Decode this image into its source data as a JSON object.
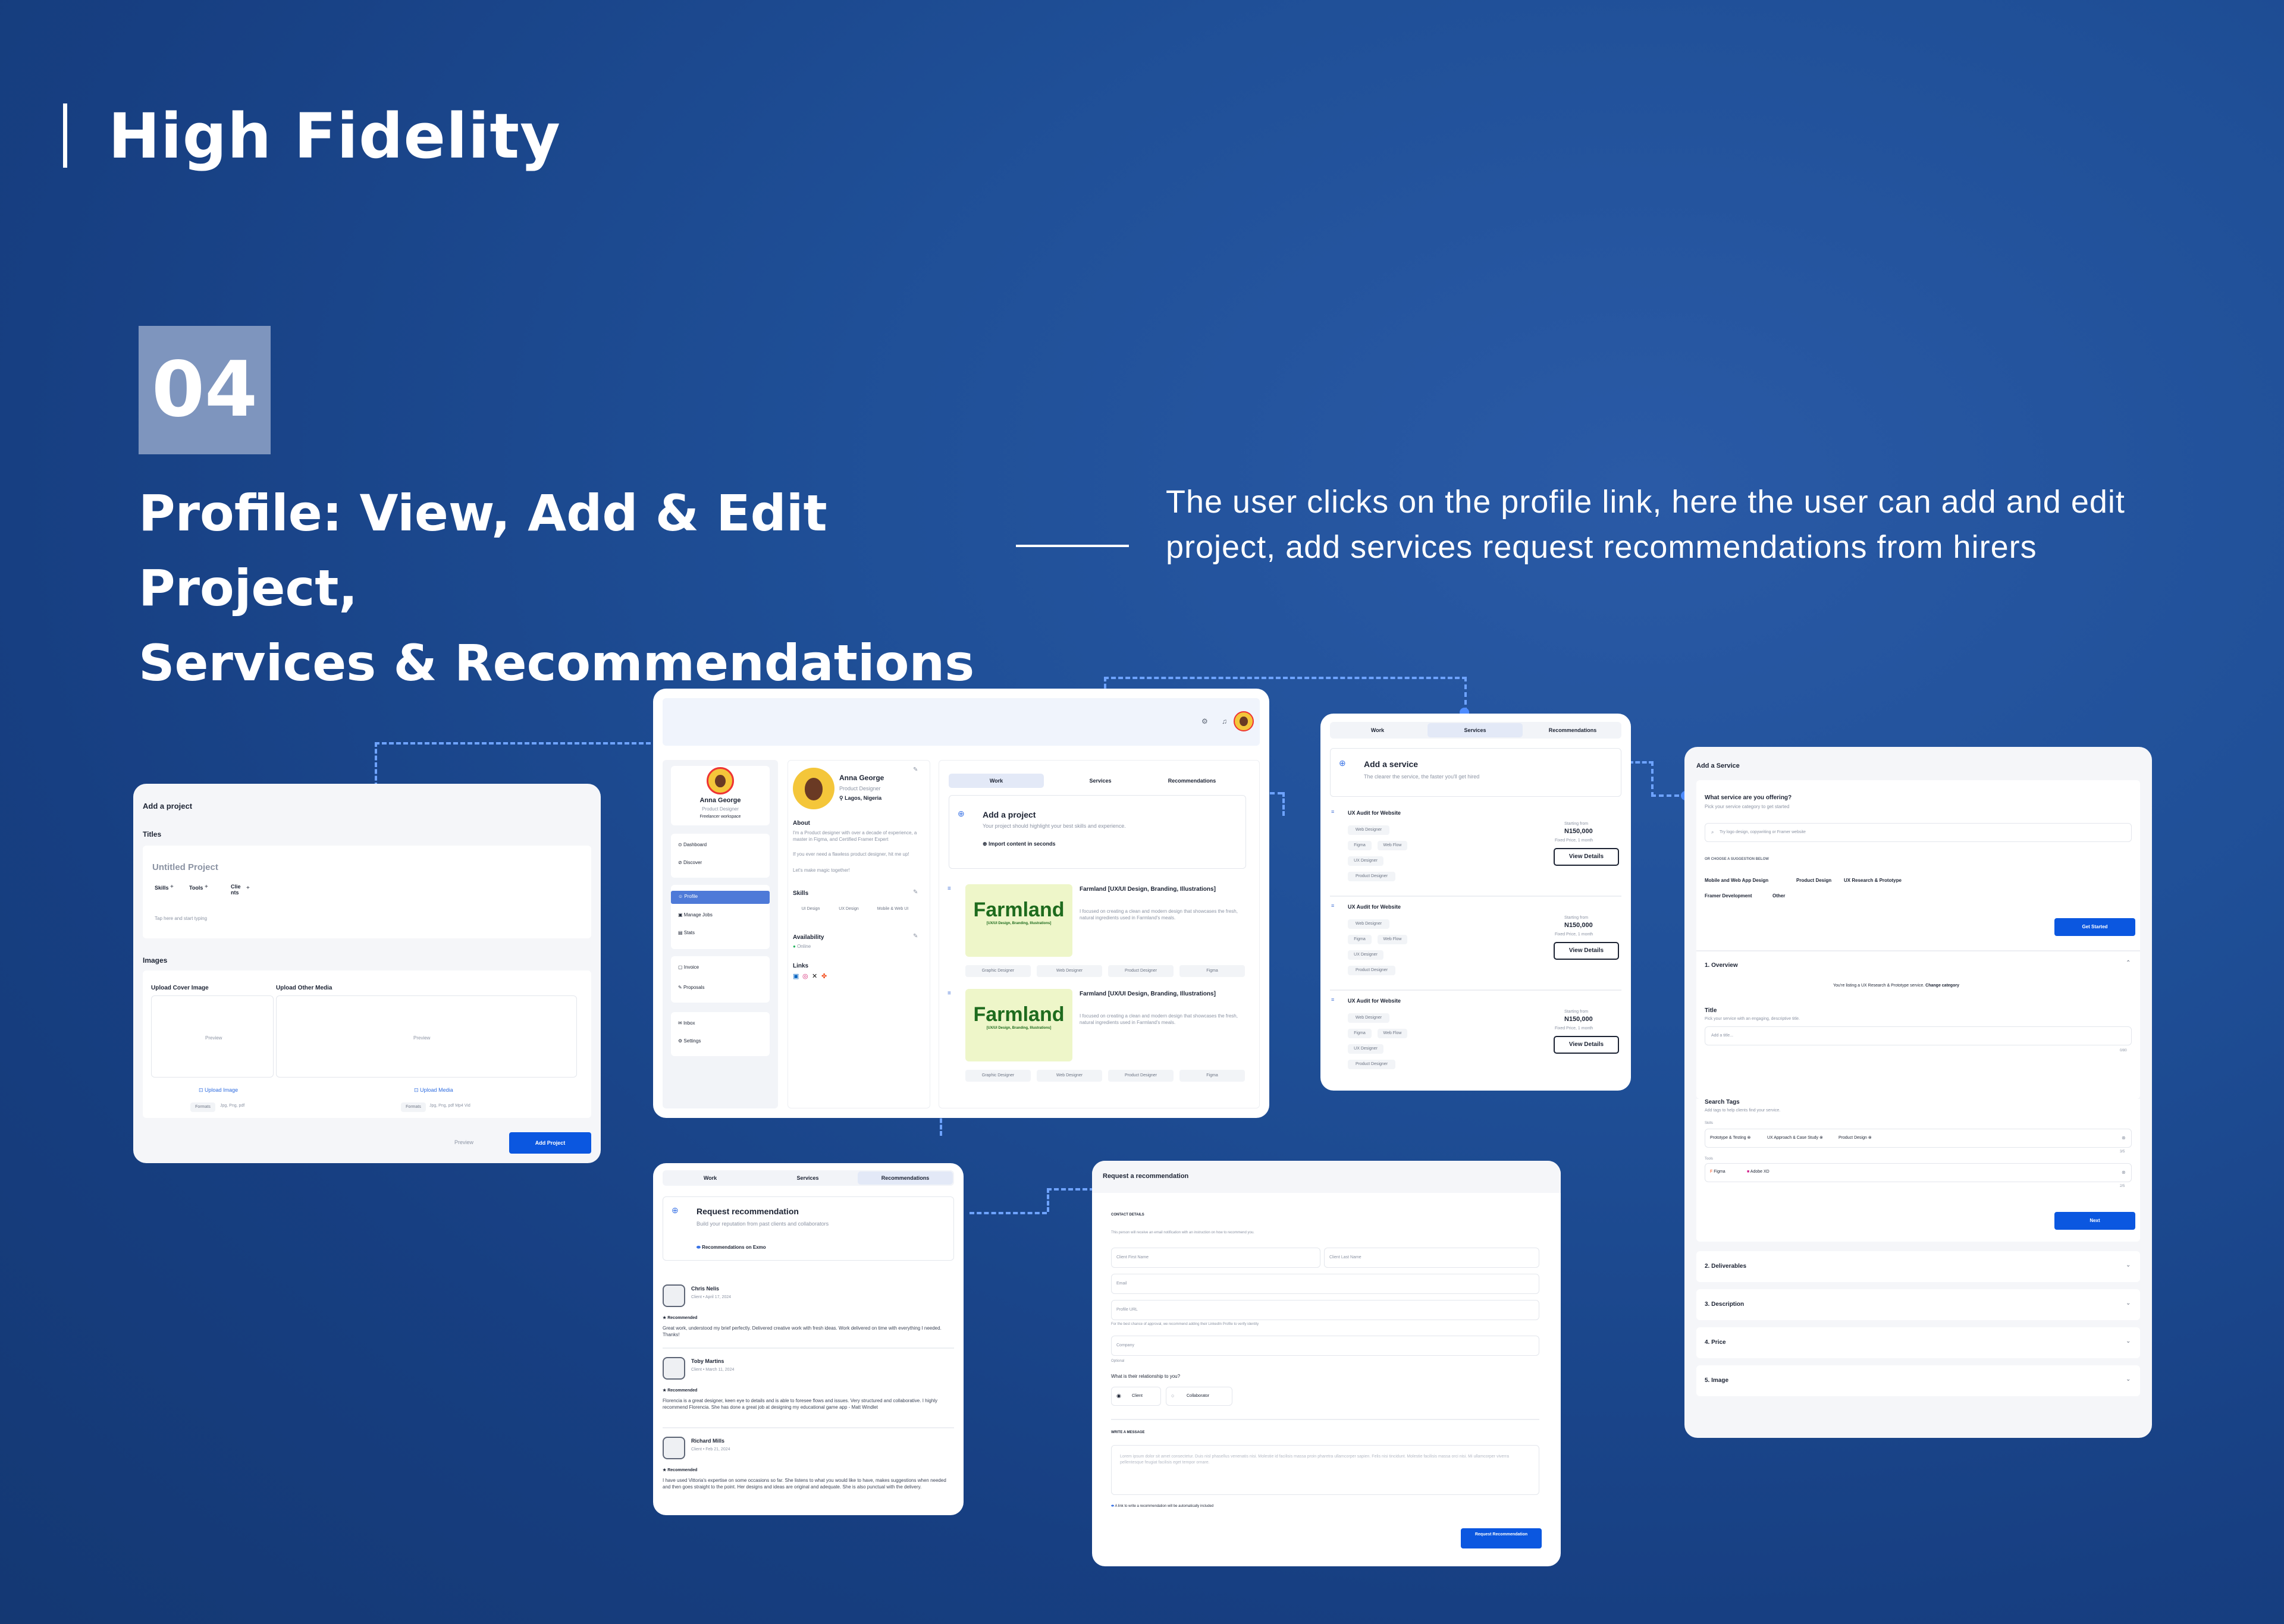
{
  "header": {
    "title": "High Fidelity"
  },
  "section": {
    "number": "04",
    "title_line1": "Profile: View, Add & Edit Project,",
    "title_line2": "Services & Recommendations",
    "description": "The user clicks on the profile link, here the user can add and edit project, add services request recommendations from hirers"
  },
  "add_project": {
    "heading": "Add a project",
    "titles_label": "Titles",
    "title_placeholder": "Untitled Project",
    "skills": "Skills",
    "tools": "Tools",
    "clients": "Clie nts",
    "body_placeholder": "Tap here and start typing",
    "images_label": "Images",
    "cover_label": "Upload Cover Image",
    "media_label": "Upload Other Media",
    "preview": "Preview",
    "upload_image": "Upload Image",
    "upload_media": "Upload Media",
    "formats": "Formats",
    "cover_formats": "Jpg, Png, pdf",
    "media_formats": "Jpg, Png, pdf Mp4 Vid",
    "preview_button": "Preview",
    "add_button": "Add Project"
  },
  "profile": {
    "name": "Anna George",
    "role": "Product Designer",
    "workspace": "Freelancer workspace",
    "nav": [
      "Dashboard",
      "Discover",
      "Profile",
      "Manage Jobs",
      "Stats",
      "Invoice",
      "Proposals",
      "Inbox",
      "Settings"
    ],
    "location": "Lagos, Nigeria",
    "about_label": "About",
    "about_text": "I'm a Product designer with over a decade of experience, a master in Figma, and Certified Framer Expert",
    "about_text2": "If you ever need a flawless product designer, hit me up!",
    "about_text3": "Let's make magic together!",
    "skills_label": "Skills",
    "skills": [
      "UI Design",
      "UX Design",
      "Mobile & Web UI"
    ],
    "availability_label": "Availability",
    "availability_value": "Online",
    "links_label": "Links",
    "tabs": [
      "Work",
      "Services",
      "Recommendations"
    ],
    "add_project_title": "Add a project",
    "add_project_sub": "Your project should highlight your best skills and experience.",
    "import_label": "Import content in seconds",
    "projects": [
      {
        "title": "Farmland [UX/UI Design, Branding, Illustrations]",
        "desc": "I focused on creating a clean and modern design that showcases the fresh, natural ingredients used in Farmland's meals.",
        "logo": "Farmland",
        "logo_sub": "[UX/UI Design, Branding, Illustrations]",
        "tags": [
          "Graphic Designer",
          "Web Designer",
          "Product Designer",
          "Figma"
        ]
      },
      {
        "title": "Farmland [UX/UI Design, Branding, Illustrations]",
        "desc": "I focused on creating a clean and modern design that showcases the fresh, natural ingredients used in Farmland's meals.",
        "logo": "Farmland",
        "logo_sub": "[UX/UI Design, Branding, Illustrations]",
        "tags": [
          "Graphic Designer",
          "Web Designer",
          "Product Designer",
          "Figma"
        ]
      }
    ]
  },
  "services": {
    "tabs": [
      "Work",
      "Services",
      "Recommendations"
    ],
    "add_title": "Add a service",
    "add_sub": "The clearer the service, the faster you'll get hired",
    "items": [
      {
        "title": "UX Audit for Website",
        "tags": [
          "Web Designer",
          "Figma",
          "Web Flow",
          "UX Designer",
          "Product Designer"
        ],
        "starting": "Starting from",
        "price": "N150,000",
        "terms": "Fixed Price, 1 month",
        "button": "View Details"
      },
      {
        "title": "UX Audit for Website",
        "tags": [
          "Web Designer",
          "Figma",
          "Web Flow",
          "UX Designer",
          "Product Designer"
        ],
        "starting": "Starting from",
        "price": "N150,000",
        "terms": "Fixed Price, 1 month",
        "button": "View Details"
      },
      {
        "title": "UX Audit for Website",
        "tags": [
          "Web Designer",
          "Figma",
          "Web Flow",
          "UX Designer",
          "Product Designer"
        ],
        "starting": "Starting from",
        "price": "N150,000",
        "terms": "Fixed Price, 1 month",
        "button": "View Details"
      }
    ]
  },
  "add_service": {
    "heading": "Add a Service",
    "question": "What service are you offering?",
    "question_sub": "Pick your service category to get started",
    "search_placeholder": "Try logo design, copywriting or Framer website",
    "suggest_label": "OR CHOOSE A SUGGESTION BELOW",
    "suggestions": [
      "Mobile and Web App Design",
      "Product Design",
      "UX Research & Prototype",
      "Framer Development",
      "Other"
    ],
    "get_started": "Get Started",
    "overview_label": "1. Overview",
    "listing_text": "You're listing a UX Research & Prototype service.",
    "change_category": "Change category",
    "title_label": "Title",
    "title_sub": "Pick your service with an engaging, descriptive title.",
    "title_placeholder": "Add a title...",
    "counter": "0/80",
    "search_tags_label": "Search Tags",
    "search_tags_sub": "Add tags to help clients find your service.",
    "skills_label": "Skills",
    "skill_tags": [
      "Prototype & Testing",
      "UX Approach & Case Study",
      "Product Design"
    ],
    "skill_count": "3/5",
    "tools_label": "Tools",
    "tool_tags": [
      "Figma",
      "Adobe XD"
    ],
    "tool_count": "2/5",
    "next": "Next",
    "sections": [
      "2. Deliverables",
      "3. Description",
      "4. Price",
      "5. Image"
    ]
  },
  "recommendations": {
    "tabs": [
      "Work",
      "Services",
      "Recommendations"
    ],
    "title": "Request recommendation",
    "sub": "Build your reputation from past clients and collaborators",
    "link": "Recommendations on Exmo",
    "items": [
      {
        "name": "Chris Nelis",
        "meta": "Client • April 17, 2024",
        "badge": "Recommended",
        "text": "Great work, understood my brief perfectly. Delivered creative work with fresh ideas. Work delivered on time with everything I needed. Thanks!"
      },
      {
        "name": "Toby Martins",
        "meta": "Client • March 11, 2024",
        "badge": "Recommended",
        "text": "Florencia is a great designer, keen eye to details and is able to foresee flows and issues. Very structured and collaborative. I highly recommend Florencia. She has done a great job at designing my educational game app - Matt Windlet"
      },
      {
        "name": "Richard Mills",
        "meta": "Client • Feb 21, 2024",
        "badge": "Recommended",
        "text": "I have used Vittoria's expertise on some occasions so far. She listens to what you would like to have, makes suggestions when needed and then goes straight to the point. Her designs and ideas are original and adequate. She is also punctual with the delivery."
      }
    ]
  },
  "request_form": {
    "heading": "Request a recommendation",
    "contact_label": "CONTACT DETAILS",
    "contact_sub": "This person will receive an email notification with an instruction on how to recommend you.",
    "first_name": "Client First Name",
    "last_name": "Client Last Name",
    "email": "Email",
    "profile_url": "Profile URL",
    "profile_hint": "For the best chance of approval, we recommend adding their LinkedIn Profile to verify identity",
    "company": "Company",
    "optional": "Optional",
    "relationship_q": "What is their relationship to you?",
    "options": [
      "Client",
      "Collaborator"
    ],
    "message_label": "WRITE A MESSAGE",
    "message_placeholder": "Lorem ipsum dolor sit amet consectetur. Duis nisl phasellus venenatis nisi. Molestie id facilisis massa proin pharetra ullamcorper sapien. Felis nisi tincidunt. Molestie facilisis massa orci nisi. Mi ullamcorper viverra pellentesque feugiat facilisis eget tempor ornare.",
    "link_note": "A link to write a recommendation will be automatically included",
    "submit": "Request Recommendation"
  },
  "colors": {
    "accent": "#0b57e0",
    "dash": "#6ea3ff",
    "background": "#1f4f97"
  }
}
